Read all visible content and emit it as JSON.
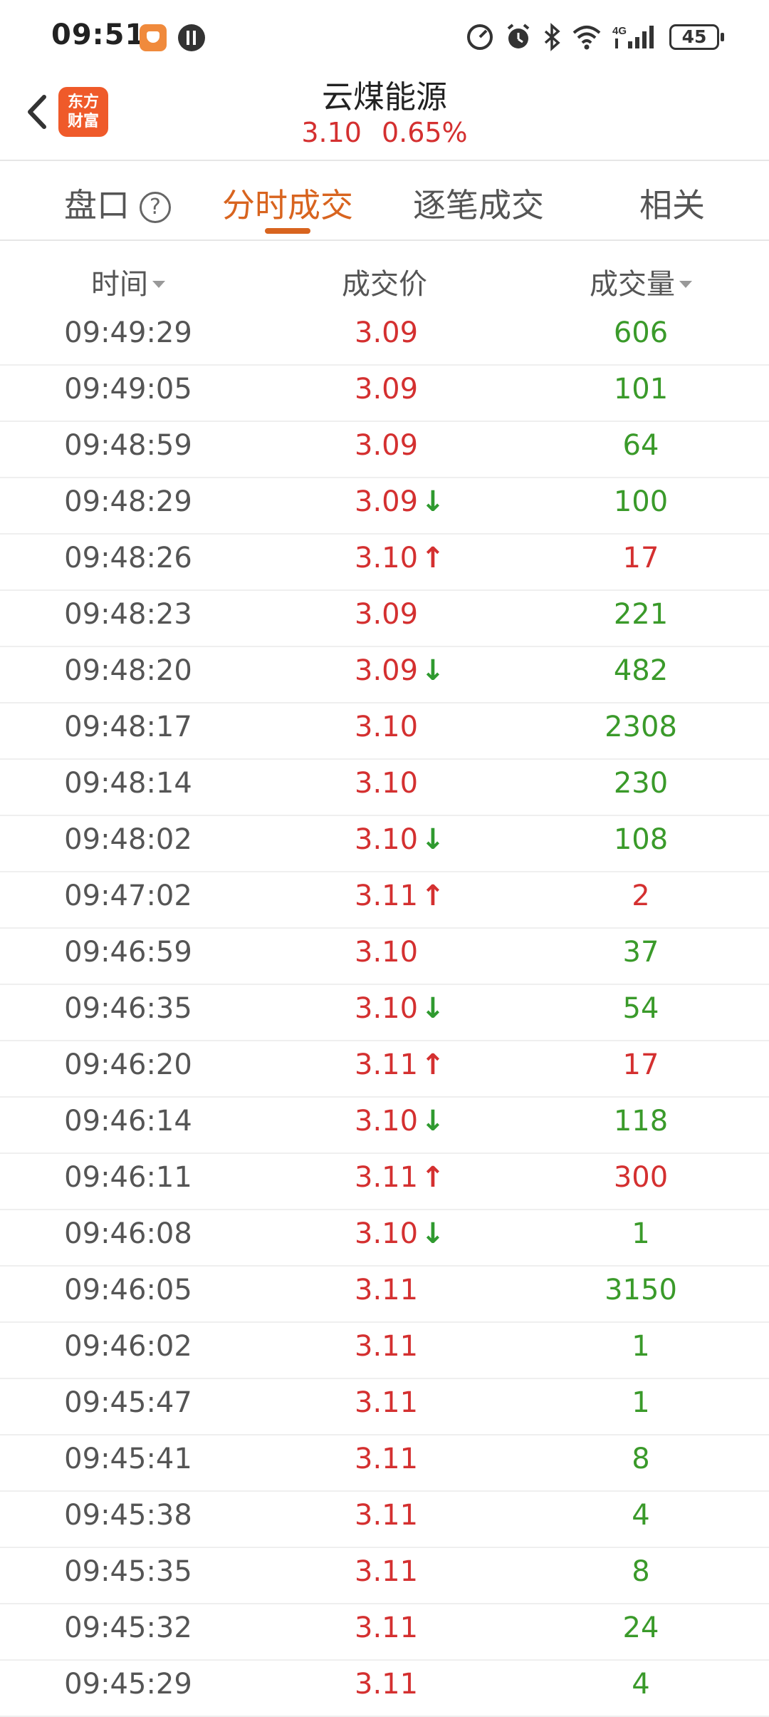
{
  "status_bar": {
    "time": "09:51",
    "battery": "45",
    "icons": [
      "speed-icon",
      "alarm-icon",
      "bluetooth-icon",
      "wifi-icon",
      "signal-4g-icon",
      "battery-icon"
    ]
  },
  "header": {
    "title": "云煤能源",
    "price": "3.10",
    "change_pct": "0.65%",
    "logo_line1": "东方",
    "logo_line2": "财富"
  },
  "tabs": [
    {
      "label": "盘口",
      "active": false
    },
    {
      "label": "分时成交",
      "active": true
    },
    {
      "label": "逐笔成交",
      "active": false
    },
    {
      "label": "相关",
      "active": false
    }
  ],
  "columns": {
    "time": "时间",
    "price": "成交价",
    "volume": "成交量"
  },
  "colors": {
    "up": "#d43030",
    "down": "#2f9a2f",
    "accent": "#d8641f"
  },
  "trades": [
    {
      "time": "09:49:29",
      "price": "3.09",
      "dir": "",
      "vol": "606",
      "vol_color": "green"
    },
    {
      "time": "09:49:05",
      "price": "3.09",
      "dir": "",
      "vol": "101",
      "vol_color": "green"
    },
    {
      "time": "09:48:59",
      "price": "3.09",
      "dir": "",
      "vol": "64",
      "vol_color": "green"
    },
    {
      "time": "09:48:29",
      "price": "3.09",
      "dir": "down",
      "vol": "100",
      "vol_color": "green"
    },
    {
      "time": "09:48:26",
      "price": "3.10",
      "dir": "up",
      "vol": "17",
      "vol_color": "red"
    },
    {
      "time": "09:48:23",
      "price": "3.09",
      "dir": "",
      "vol": "221",
      "vol_color": "green"
    },
    {
      "time": "09:48:20",
      "price": "3.09",
      "dir": "down",
      "vol": "482",
      "vol_color": "green"
    },
    {
      "time": "09:48:17",
      "price": "3.10",
      "dir": "",
      "vol": "2308",
      "vol_color": "green"
    },
    {
      "time": "09:48:14",
      "price": "3.10",
      "dir": "",
      "vol": "230",
      "vol_color": "green"
    },
    {
      "time": "09:48:02",
      "price": "3.10",
      "dir": "down",
      "vol": "108",
      "vol_color": "green"
    },
    {
      "time": "09:47:02",
      "price": "3.11",
      "dir": "up",
      "vol": "2",
      "vol_color": "red"
    },
    {
      "time": "09:46:59",
      "price": "3.10",
      "dir": "",
      "vol": "37",
      "vol_color": "green"
    },
    {
      "time": "09:46:35",
      "price": "3.10",
      "dir": "down",
      "vol": "54",
      "vol_color": "green"
    },
    {
      "time": "09:46:20",
      "price": "3.11",
      "dir": "up",
      "vol": "17",
      "vol_color": "red"
    },
    {
      "time": "09:46:14",
      "price": "3.10",
      "dir": "down",
      "vol": "118",
      "vol_color": "green"
    },
    {
      "time": "09:46:11",
      "price": "3.11",
      "dir": "up",
      "vol": "300",
      "vol_color": "red"
    },
    {
      "time": "09:46:08",
      "price": "3.10",
      "dir": "down",
      "vol": "1",
      "vol_color": "green"
    },
    {
      "time": "09:46:05",
      "price": "3.11",
      "dir": "",
      "vol": "3150",
      "vol_color": "green"
    },
    {
      "time": "09:46:02",
      "price": "3.11",
      "dir": "",
      "vol": "1",
      "vol_color": "green"
    },
    {
      "time": "09:45:47",
      "price": "3.11",
      "dir": "",
      "vol": "1",
      "vol_color": "green"
    },
    {
      "time": "09:45:41",
      "price": "3.11",
      "dir": "",
      "vol": "8",
      "vol_color": "green"
    },
    {
      "time": "09:45:38",
      "price": "3.11",
      "dir": "",
      "vol": "4",
      "vol_color": "green"
    },
    {
      "time": "09:45:35",
      "price": "3.11",
      "dir": "",
      "vol": "8",
      "vol_color": "green"
    },
    {
      "time": "09:45:32",
      "price": "3.11",
      "dir": "",
      "vol": "24",
      "vol_color": "green"
    },
    {
      "time": "09:45:29",
      "price": "3.11",
      "dir": "",
      "vol": "4",
      "vol_color": "green"
    }
  ]
}
